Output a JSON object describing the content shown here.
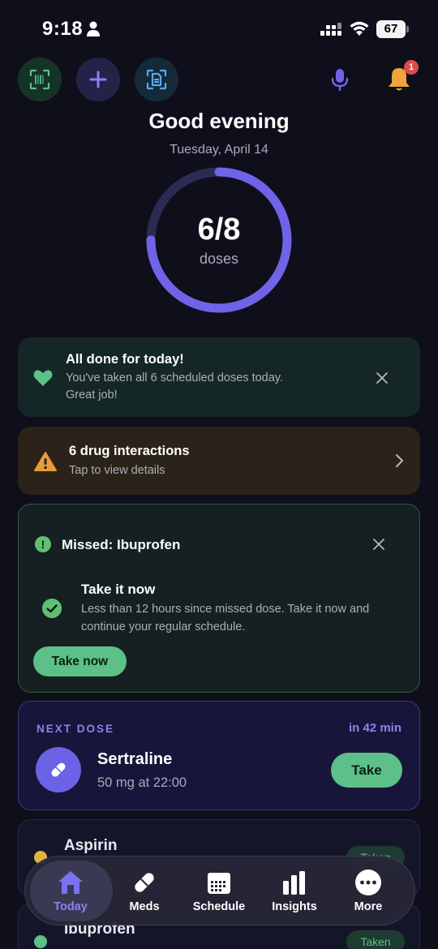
{
  "status_bar": {
    "time": "9:18",
    "battery": "67"
  },
  "header": {
    "notification_count": "1"
  },
  "greeting": {
    "title": "Good evening",
    "date": "Tuesday, April 14"
  },
  "progress": {
    "value_text": "6/8",
    "label": "doses",
    "taken": 6,
    "total": 8,
    "ring_color": "#6f64e8",
    "track_color": "#2c2b52"
  },
  "all_done": {
    "title": "All done for today!",
    "line1": "You've taken all 6 scheduled doses today.",
    "line2": "Great job!"
  },
  "interactions": {
    "title": "6 drug interactions",
    "subtitle": "Tap to view details"
  },
  "missed": {
    "title": "Missed: Ibuprofen",
    "advice_title": "Take it now",
    "advice_line1": "Less than 12 hours since missed dose. Take it now and",
    "advice_line2": "continue your regular schedule.",
    "button": "Take now"
  },
  "next_dose": {
    "label": "NEXT DOSE",
    "eta": "in 42 min",
    "med_name": "Sertraline",
    "dose": "50 mg at 22:00",
    "button": "Take"
  },
  "med_list": [
    {
      "name": "Aspirin",
      "status": "Taken",
      "dot_color": "#e3b341"
    },
    {
      "name": "Ibuprofen",
      "status": "Taken",
      "dot_color": "#5cc088"
    }
  ],
  "tabs": [
    {
      "label": "Today",
      "icon": "home-icon",
      "active": true
    },
    {
      "label": "Meds",
      "icon": "pill-icon",
      "active": false
    },
    {
      "label": "Schedule",
      "icon": "calendar-icon",
      "active": false
    },
    {
      "label": "Insights",
      "icon": "bar-chart-icon",
      "active": false
    },
    {
      "label": "More",
      "icon": "more-icon",
      "active": false
    }
  ],
  "colors": {
    "accent": "#8b82f4",
    "success": "#5cc088",
    "warning": "#e89b3a",
    "danger": "#e24a4a"
  }
}
